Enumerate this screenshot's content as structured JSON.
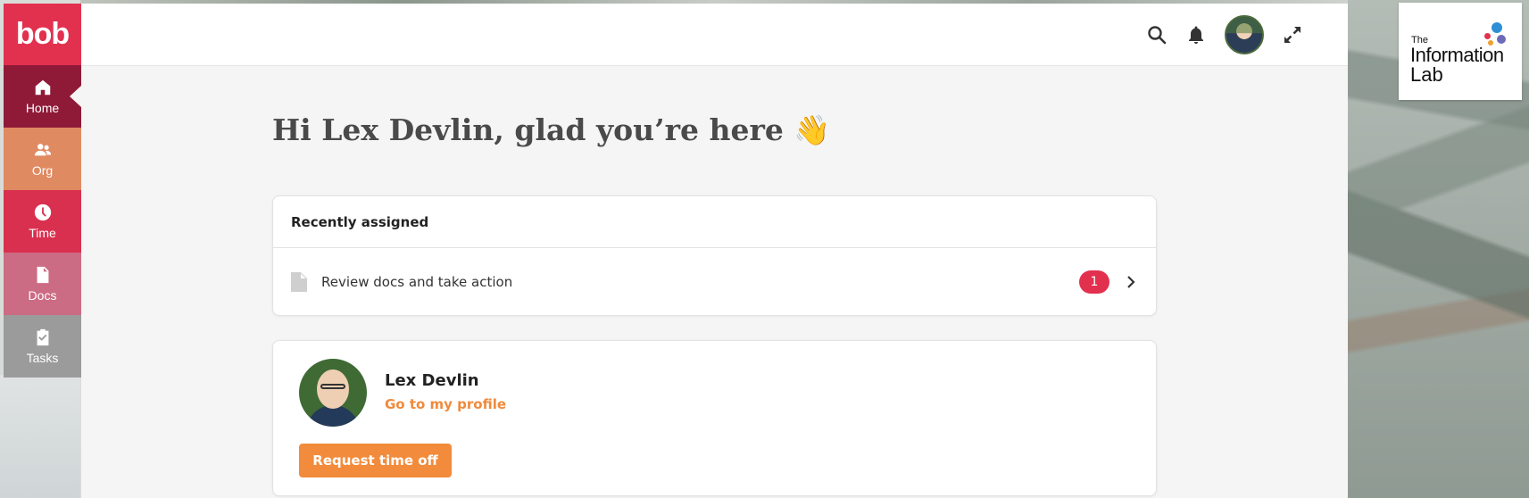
{
  "app": {
    "logo_text": "bob"
  },
  "sidebar": {
    "items": [
      {
        "label": "Home",
        "icon": "home-icon",
        "active": true
      },
      {
        "label": "Org",
        "icon": "people-icon"
      },
      {
        "label": "Time",
        "icon": "clock-icon"
      },
      {
        "label": "Docs",
        "icon": "document-icon"
      },
      {
        "label": "Tasks",
        "icon": "clipboard-check-icon"
      }
    ]
  },
  "topbar": {
    "icons": [
      "search-icon",
      "bell-icon",
      "avatar",
      "expand-icon"
    ]
  },
  "greeting": {
    "text": "Hi Lex Devlin, glad you’re here 👋"
  },
  "recently_assigned": {
    "title": "Recently assigned",
    "items": [
      {
        "label": "Review docs and take action",
        "count": "1"
      }
    ]
  },
  "profile_card": {
    "name": "Lex Devlin",
    "link": "Go to my profile",
    "action_button": "Request time off"
  },
  "company_logo": {
    "line1": "The",
    "line2": "Information",
    "line3": "Lab"
  },
  "colors": {
    "brand_red": "#e2304f",
    "home_active": "#8f1a38",
    "org": "#e08a62",
    "time": "#d9304f",
    "docs": "#cc6b84",
    "tasks": "#9b9b9b",
    "accent_orange": "#f28b3b"
  }
}
